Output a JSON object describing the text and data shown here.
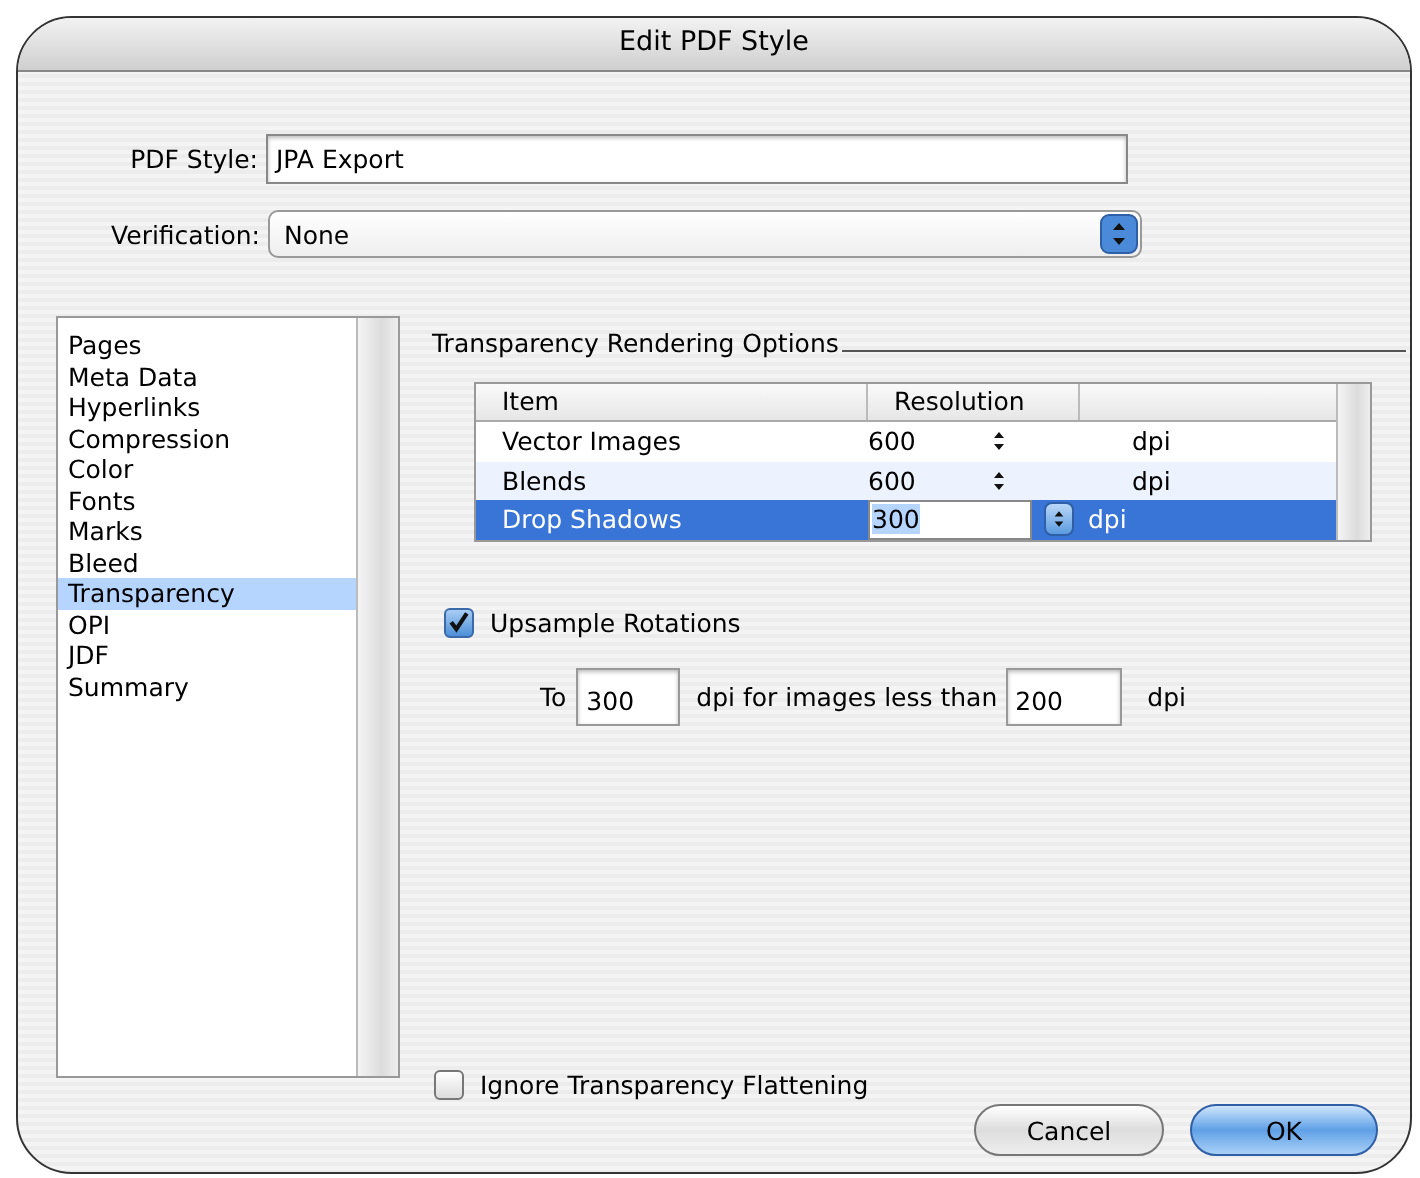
{
  "window": {
    "title": "Edit PDF Style"
  },
  "pdf_style": {
    "label": "PDF Style:",
    "value": "JPA Export"
  },
  "verification": {
    "label": "Verification:",
    "value": "None"
  },
  "sidebar": {
    "items": [
      {
        "label": "Pages",
        "selected": false
      },
      {
        "label": "Meta Data",
        "selected": false
      },
      {
        "label": "Hyperlinks",
        "selected": false
      },
      {
        "label": "Compression",
        "selected": false
      },
      {
        "label": "Color",
        "selected": false
      },
      {
        "label": "Fonts",
        "selected": false
      },
      {
        "label": "Marks",
        "selected": false
      },
      {
        "label": "Bleed",
        "selected": false
      },
      {
        "label": "Transparency",
        "selected": true
      },
      {
        "label": "OPI",
        "selected": false
      },
      {
        "label": "JDF",
        "selected": false
      },
      {
        "label": "Summary",
        "selected": false
      }
    ]
  },
  "section": {
    "title": "Transparency Rendering Options",
    "table": {
      "columns": [
        "Item",
        "Resolution"
      ],
      "rows": [
        {
          "item": "Vector Images",
          "resolution": "600",
          "unit": "dpi",
          "selected": false
        },
        {
          "item": "Blends",
          "resolution": "600",
          "unit": "dpi",
          "selected": false
        },
        {
          "item": "Drop Shadows",
          "resolution": "300",
          "unit": "dpi",
          "selected": true
        }
      ]
    }
  },
  "upsample": {
    "label": "Upsample Rotations",
    "checked": true,
    "prefix": "To",
    "value": "300",
    "middle": "dpi for images less than",
    "threshold": "200",
    "suffix": "dpi"
  },
  "ignore_flattening": {
    "label": "Ignore Transparency Flattening",
    "checked": false
  },
  "buttons": [
    {
      "label": "Cancel",
      "kind": "secondary"
    },
    {
      "label": "OK",
      "kind": "default"
    }
  ]
}
